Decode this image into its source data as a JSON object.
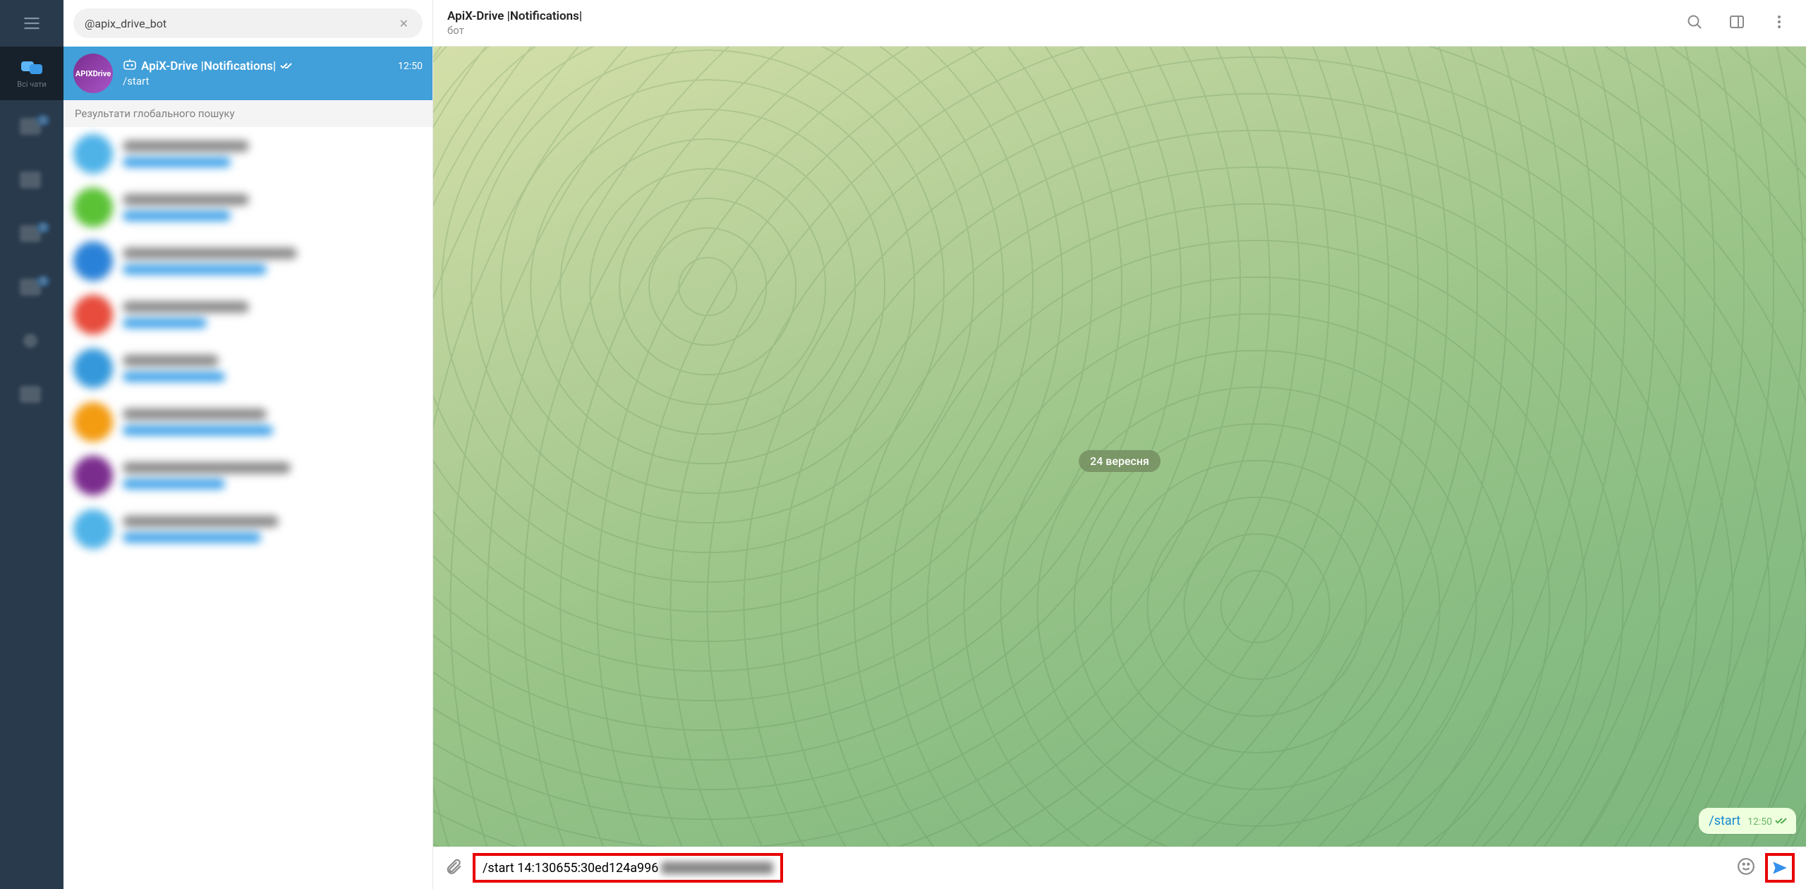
{
  "folders": {
    "menu_icon": "menu",
    "items": [
      {
        "label": "Всі чати",
        "active": true,
        "badge": ""
      },
      {
        "label": "",
        "badge": "2"
      },
      {
        "label": "",
        "badge": ""
      },
      {
        "label": "",
        "badge": "2"
      },
      {
        "label": "",
        "badge": "5"
      },
      {
        "label": "",
        "badge": ""
      },
      {
        "label": "",
        "badge": ""
      }
    ]
  },
  "search": {
    "value": "@apix_drive_bot",
    "clear_icon": "✕"
  },
  "selected_chat": {
    "avatar_text": "APIXDrive",
    "title": "ApiX-Drive |Notifications|",
    "subtitle": "/start",
    "time": "12:50",
    "bot_icon": "bot"
  },
  "global_section_label": "Результати глобального пошуку",
  "global_results": [
    {
      "avatar_color": "#4fb3e8"
    },
    {
      "avatar_color": "#5bc236"
    },
    {
      "avatar_color": "#2a82d8"
    },
    {
      "avatar_color": "#e74c3c"
    },
    {
      "avatar_color": "#3498db"
    },
    {
      "avatar_color": "#f39c12"
    },
    {
      "avatar_color": "#7b2d8e"
    },
    {
      "avatar_color": "#4fb3e8"
    }
  ],
  "header": {
    "name": "ApiX-Drive |Notifications|",
    "status": "бот"
  },
  "messages": {
    "date_label": "24 вересня",
    "outgoing": {
      "text": "/start",
      "time": "12:50"
    }
  },
  "composer": {
    "typed_prefix": "/start 14:130655:30ed124a996",
    "attach_icon": "paperclip",
    "emoji_icon": "emoji",
    "send_icon": "send"
  }
}
